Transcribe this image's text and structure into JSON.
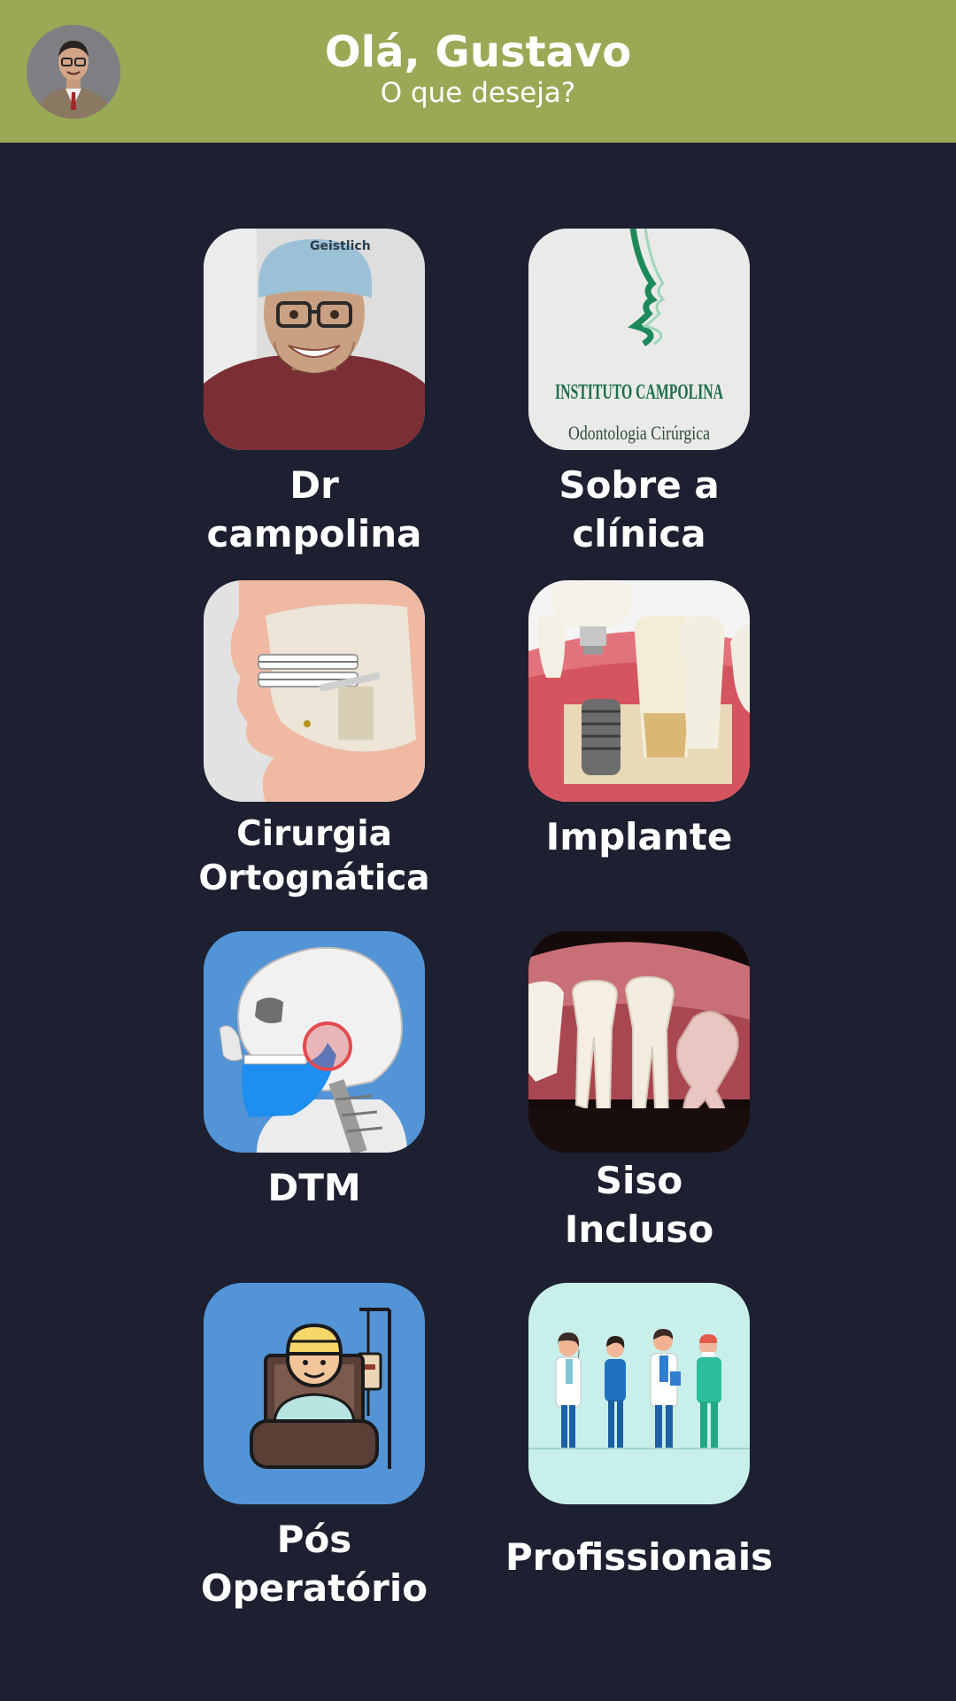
{
  "header": {
    "greeting": "Olá, Gustavo",
    "subtitle": "O que deseja?",
    "avatar_icon": "user-avatar",
    "background_color": "#9aa955"
  },
  "page": {
    "background_color": "#1c2030"
  },
  "menu": {
    "items": [
      {
        "line1": "Dr",
        "line2": "campolina",
        "icon": "doctor-photo"
      },
      {
        "line1": "Sobre a",
        "line2": "clínica",
        "icon": "clinic-sign-photo",
        "image_text": "INSTITUTO CAMPOLINA",
        "image_subtext": "Odontologia Cirúrgica"
      },
      {
        "line1": "Cirurgia",
        "line2": "Ortognática",
        "icon": "jaw-surgery-illustration"
      },
      {
        "line1": "Implante",
        "line2": "",
        "icon": "dental-implant-illustration"
      },
      {
        "line1": "DTM",
        "line2": "",
        "icon": "tmj-skull-illustration"
      },
      {
        "line1": "Siso",
        "line2": "Incluso",
        "icon": "wisdom-tooth-illustration"
      },
      {
        "line1": "Pós",
        "line2": "Operatório",
        "icon": "post-op-patient-illustration"
      },
      {
        "line1": "Profissionais",
        "line2": "",
        "icon": "professionals-team-illustration"
      }
    ]
  }
}
